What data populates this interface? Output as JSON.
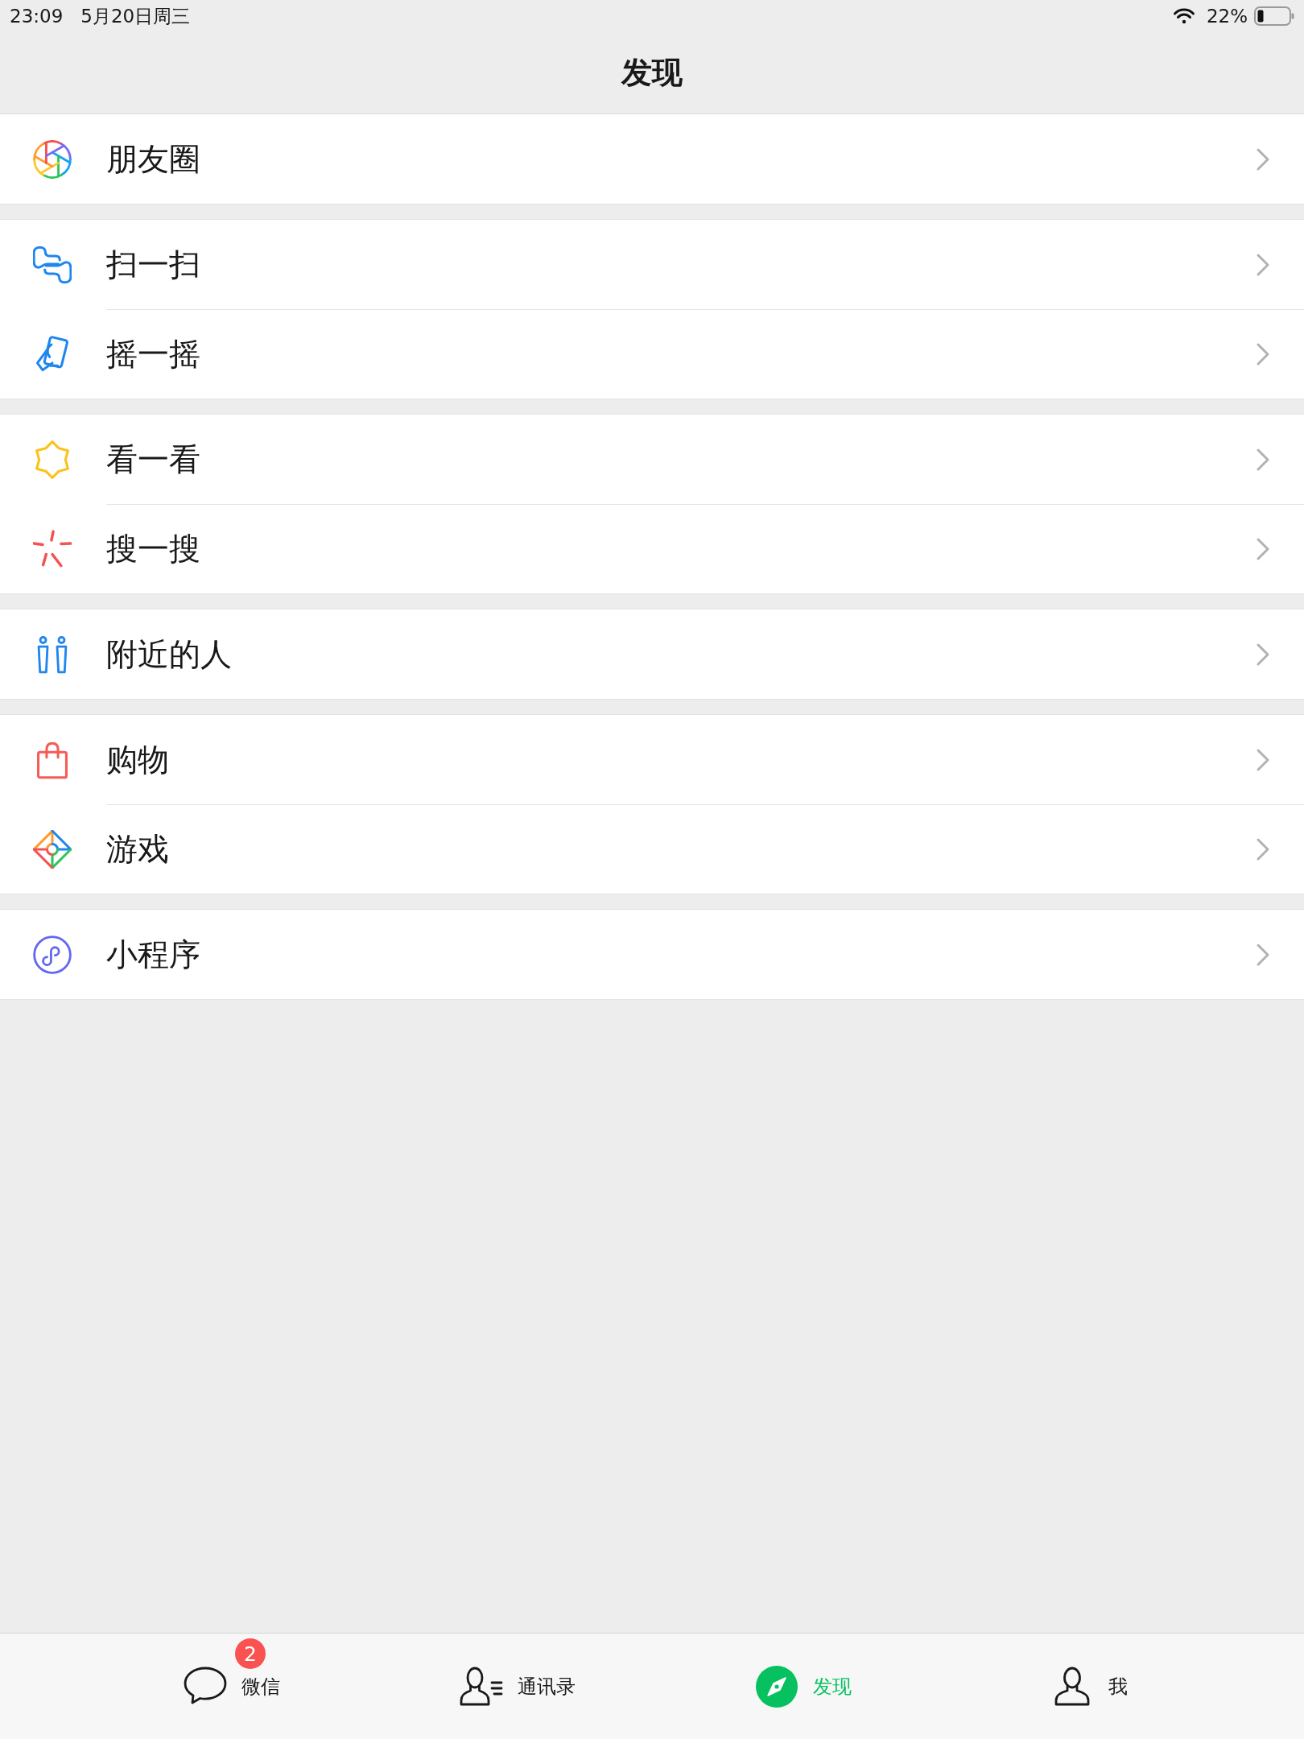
{
  "status_bar": {
    "time": "23:09",
    "date": "5月20日周三",
    "battery": "22%"
  },
  "nav_bar": {
    "title": "发现"
  },
  "groups": [
    {
      "items": [
        {
          "kind": "aperture",
          "label": "朋友圈"
        }
      ]
    },
    {
      "items": [
        {
          "kind": "scan",
          "label": "扫一扫"
        },
        {
          "kind": "shake",
          "label": "摇一摇"
        }
      ]
    },
    {
      "items": [
        {
          "kind": "star",
          "label": "看一看"
        },
        {
          "kind": "burst",
          "label": "搜一搜"
        }
      ]
    },
    {
      "items": [
        {
          "kind": "people",
          "label": "附近的人"
        }
      ]
    },
    {
      "items": [
        {
          "kind": "bag",
          "label": "购物"
        },
        {
          "kind": "diamond",
          "label": "游戏"
        }
      ]
    },
    {
      "items": [
        {
          "kind": "loop",
          "label": "小程序"
        }
      ]
    }
  ],
  "tab_bar": {
    "tabs": [
      {
        "kind": "chat",
        "label": "微信",
        "badge": "2",
        "selected": false
      },
      {
        "kind": "contacts",
        "label": "通讯录",
        "selected": false
      },
      {
        "kind": "compass",
        "label": "发现",
        "selected": true
      },
      {
        "kind": "person",
        "label": "我",
        "selected": false
      }
    ]
  }
}
